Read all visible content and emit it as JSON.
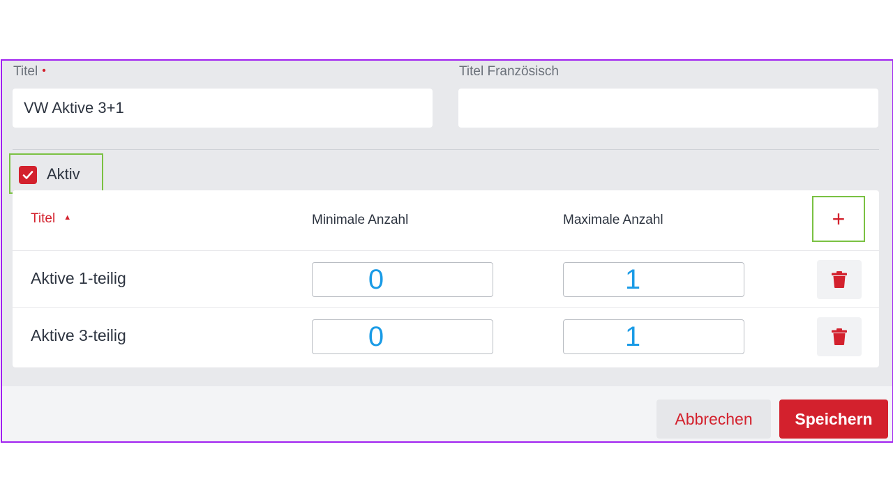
{
  "form": {
    "title_label": "Titel",
    "title_required_marker": "•",
    "title_value": "VW Aktive 3+1",
    "title_fr_label": "Titel Französisch",
    "title_fr_value": ""
  },
  "aktiv": {
    "label": "Aktiv",
    "checked": true
  },
  "table": {
    "headers": {
      "title": "Titel",
      "min": "Minimale Anzahl",
      "max": "Maximale Anzahl"
    },
    "sort_indicator": "▲",
    "add_label": "+",
    "rows": [
      {
        "title": "Aktive 1-teilig",
        "min": "0",
        "max": "1"
      },
      {
        "title": "Aktive 3-teilig",
        "min": "0",
        "max": "1"
      }
    ]
  },
  "footer": {
    "cancel_label": "Abbrechen",
    "save_label": "Speichern"
  },
  "colors": {
    "accent": "#d3212d",
    "number_blue": "#1a9be6",
    "highlight_green": "#7ac142",
    "frame_purple": "#a020f0"
  },
  "icons": [
    "check-icon",
    "plus-icon",
    "trash-icon",
    "sort-ascending-icon"
  ]
}
